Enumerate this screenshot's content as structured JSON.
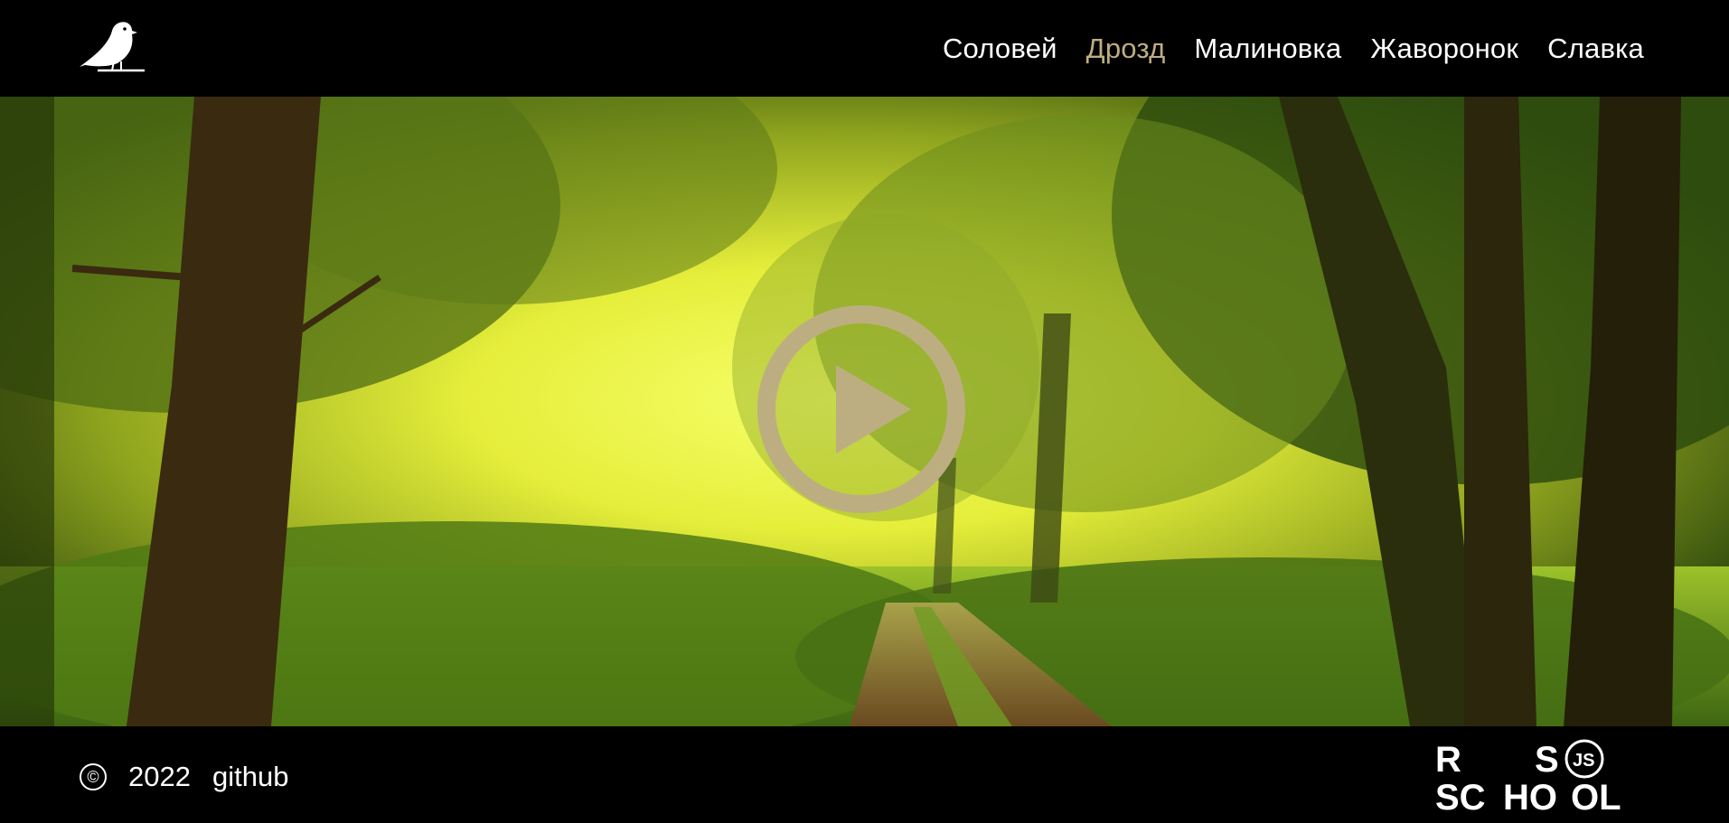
{
  "header": {
    "logo_icon": "bird-icon",
    "nav": [
      {
        "label": "Соловей",
        "active": false
      },
      {
        "label": "Дрозд",
        "active": true
      },
      {
        "label": "Малиновка",
        "active": false
      },
      {
        "label": "Жаворонок",
        "active": false
      },
      {
        "label": "Славка",
        "active": false
      }
    ]
  },
  "hero": {
    "background": "forest-path-image",
    "play_icon": "play-circle-icon",
    "accent_color": "#bdae82"
  },
  "footer": {
    "copyright_symbol": "©",
    "year": "2022",
    "github_label": "github",
    "rs_logo": {
      "line1": "R S",
      "line2": "SC HO OL",
      "badge": "JS"
    }
  }
}
